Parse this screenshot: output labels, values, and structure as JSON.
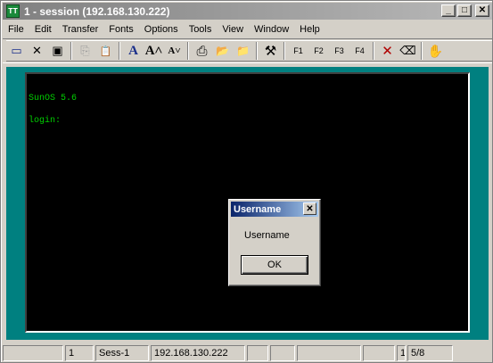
{
  "window": {
    "title": "1 - session (192.168.130.222)",
    "app_icon_text": "TT",
    "minimize_glyph": "_",
    "maximize_glyph": "□",
    "close_glyph": "✕"
  },
  "menu": {
    "items": [
      "File",
      "Edit",
      "Transfer",
      "Fonts",
      "Options",
      "Tools",
      "View",
      "Window",
      "Help"
    ]
  },
  "toolbar": {
    "buttons": [
      {
        "icon": "connect-icon",
        "glyph": "▭"
      },
      {
        "icon": "disconnect-icon",
        "glyph": "✕"
      },
      {
        "icon": "terminal-icon",
        "glyph": "▣"
      },
      {
        "icon": "copy-icon",
        "glyph": "⎘"
      },
      {
        "icon": "paste-icon",
        "glyph": "📋"
      },
      {
        "icon": "font-icon",
        "glyph": "A"
      },
      {
        "icon": "font-larger-icon",
        "glyph": "A˄"
      },
      {
        "icon": "font-smaller-icon",
        "glyph": "A˅"
      },
      {
        "icon": "print-icon",
        "glyph": "⎙"
      },
      {
        "icon": "open-folder-icon",
        "glyph": "📂"
      },
      {
        "icon": "upload-folder-icon",
        "glyph": "📁"
      },
      {
        "icon": "tools-icon",
        "glyph": "⚒"
      },
      {
        "icon": "eraser-icon",
        "glyph": "⌫"
      },
      {
        "icon": "hand-icon",
        "glyph": "✋"
      }
    ],
    "fkeys": [
      "F1",
      "F2",
      "F3",
      "F4"
    ]
  },
  "terminal": {
    "line1": "SunOS 5.6",
    "line2": "login:",
    "text_color": "#00d000",
    "background": "#000000"
  },
  "dialog": {
    "title": "Username",
    "message": "Username",
    "ok_label": "OK",
    "close_glyph": "✕"
  },
  "statusbar": {
    "cells": [
      "",
      "1",
      "Sess-1",
      "192.168.130.222",
      "",
      "",
      "",
      "",
      "1",
      "5/8"
    ]
  }
}
